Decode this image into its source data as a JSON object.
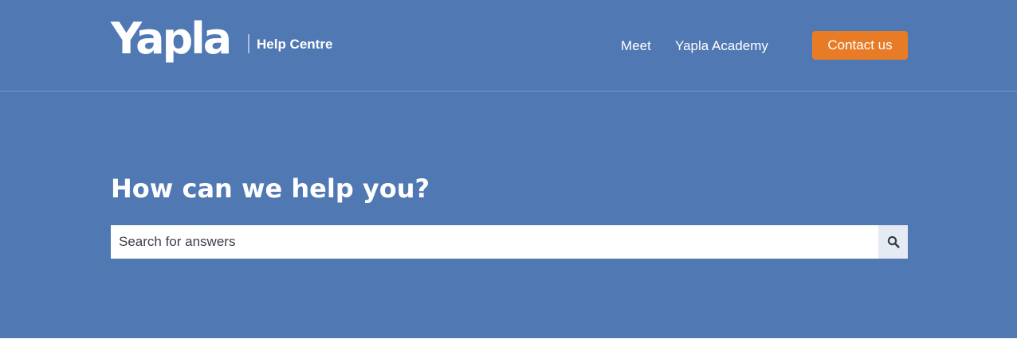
{
  "header": {
    "logo": "Yapla",
    "subtitle": "Help Centre",
    "nav": [
      {
        "label": "Meet"
      },
      {
        "label": "Yapla Academy"
      }
    ],
    "contact_label": "Contact us"
  },
  "hero": {
    "title": "How can we help you?"
  },
  "search": {
    "placeholder": "Search for answers",
    "icon": "search-icon"
  },
  "colors": {
    "background": "#5078b3",
    "accent": "#e87c26",
    "search_button": "#e6ebf3"
  }
}
